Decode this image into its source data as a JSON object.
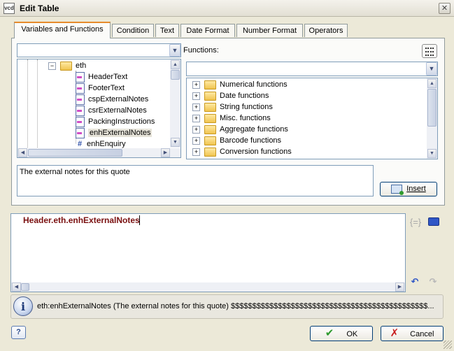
{
  "window": {
    "title": "Edit Table",
    "app_icon": "vcd-app-icon",
    "close_glyph": "✕"
  },
  "tabs": [
    {
      "label": "Variables and Functions",
      "active": true
    },
    {
      "label": "Condition"
    },
    {
      "label": "Text"
    },
    {
      "label": "Date Format"
    },
    {
      "label": "Number Format"
    },
    {
      "label": "Operators"
    }
  ],
  "variables": {
    "combo_value": "",
    "folder": "eth",
    "items": [
      {
        "label": "HeaderText",
        "icon": "text-field-icon"
      },
      {
        "label": "FooterText",
        "icon": "text-field-icon"
      },
      {
        "label": "cspExternalNotes",
        "icon": "text-field-icon"
      },
      {
        "label": "csrExternalNotes",
        "icon": "text-field-icon"
      },
      {
        "label": "PackingInstructions",
        "icon": "text-field-icon"
      },
      {
        "label": "enhExternalNotes",
        "icon": "text-field-icon",
        "selected": true
      },
      {
        "label": "enhEnquiry",
        "icon": "number-field-icon"
      }
    ]
  },
  "functions": {
    "label": "Functions:",
    "combo_value": "",
    "items": [
      "Numerical functions",
      "Date functions",
      "String functions",
      "Misc. functions",
      "Aggregate functions",
      "Barcode functions",
      "Conversion functions"
    ]
  },
  "description": "The external notes for this quote",
  "insert_button": "Insert",
  "editor": {
    "expression": "Header.eth.enhExternalNotes"
  },
  "info": {
    "text": "eth:enhExternalNotes (The external notes for this quote) $$$$$$$$$$$$$$$$$$$$$$$$$$$$$$$$$$$$$$$$$$$$$$..."
  },
  "buttons": {
    "ok": "OK",
    "cancel": "Cancel",
    "help": "?"
  },
  "colors": {
    "expression_text": "#7a1010",
    "tab_highlight": "#e68b2c",
    "ok_check": "#2e9a2e",
    "cancel_x": "#c81e1e"
  }
}
